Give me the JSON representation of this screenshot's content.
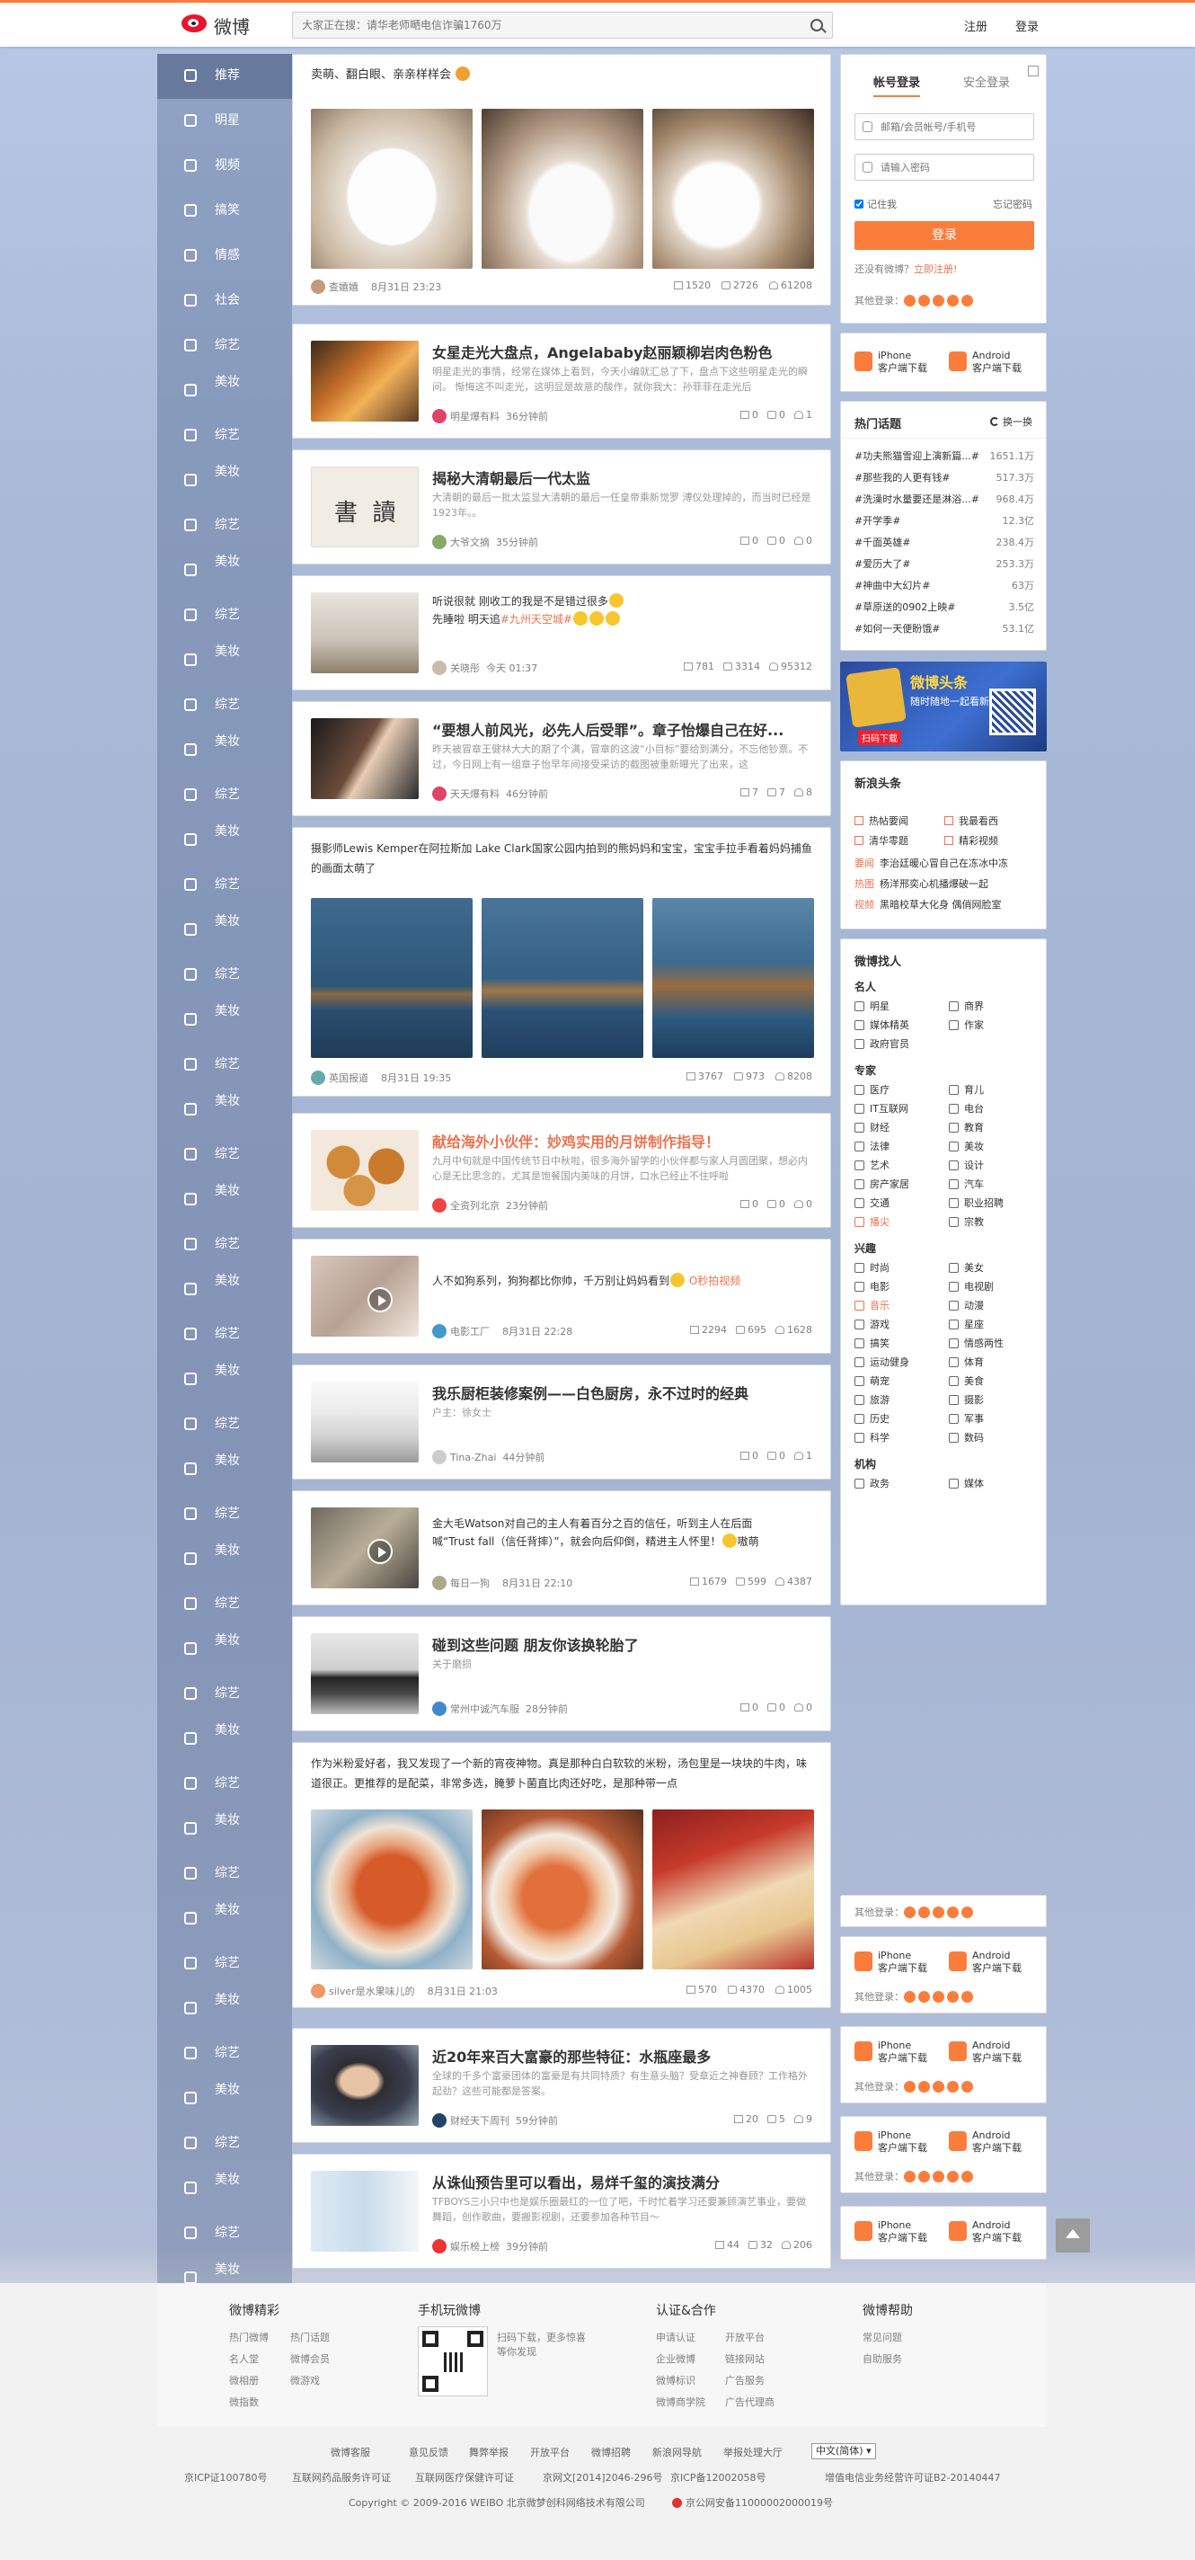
{
  "top": {
    "logo_text": "微博",
    "search_placeholder": "大家正在搜：请华老师嗮电信诈骗1760万",
    "register": "注册",
    "login": "登录"
  },
  "nav": {
    "items": [
      {
        "label": "推荐"
      },
      {
        "label": "明星"
      },
      {
        "label": "视频"
      },
      {
        "label": "搞笑"
      },
      {
        "label": "情感"
      },
      {
        "label": "社会"
      },
      {
        "label": "综艺"
      },
      {
        "label": "美妆"
      },
      {
        "label": "综艺"
      },
      {
        "label": "美妆"
      },
      {
        "label": "综艺"
      },
      {
        "label": "美妆"
      },
      {
        "label": "综艺"
      },
      {
        "label": "美妆"
      },
      {
        "label": "综艺"
      },
      {
        "label": "美妆"
      },
      {
        "label": "综艺"
      },
      {
        "label": "美妆"
      },
      {
        "label": "综艺"
      },
      {
        "label": "美妆"
      },
      {
        "label": "综艺"
      },
      {
        "label": "美妆"
      },
      {
        "label": "综艺"
      },
      {
        "label": "美妆"
      },
      {
        "label": "综艺"
      },
      {
        "label": "美妆"
      },
      {
        "label": "综艺"
      },
      {
        "label": "美妆"
      },
      {
        "label": "综艺"
      },
      {
        "label": "美妆"
      },
      {
        "label": "综艺"
      },
      {
        "label": "美妆"
      },
      {
        "label": "综艺"
      },
      {
        "label": "美妆"
      },
      {
        "label": "综艺"
      },
      {
        "label": "美妆"
      },
      {
        "label": "综艺"
      },
      {
        "label": "美妆"
      },
      {
        "label": "综艺"
      },
      {
        "label": "美妆"
      },
      {
        "label": "综艺"
      },
      {
        "label": "美妆"
      },
      {
        "label": "综艺"
      },
      {
        "label": "美妆"
      },
      {
        "label": "综艺"
      },
      {
        "label": "美妆"
      },
      {
        "label": "综艺"
      },
      {
        "label": "美妆"
      },
      {
        "label": "综艺"
      },
      {
        "label": "美妆"
      }
    ]
  },
  "feed": {
    "post1": {
      "text": "卖萌、翻白眼、亲亲样样会",
      "author": "查嬉嬉",
      "time": "8月31日 23:23",
      "repost": "1520",
      "comment": "2726",
      "like": "61208"
    },
    "post2": {
      "title": "女星走光大盘点，Angelababy赵丽颖柳岩肉色粉色",
      "desc": "明星走光的事情，经常在媒体上看到，今天小编就汇总了下，盘点下这些明星走光的瞬间。 惭悔这不叫走光，这明显是故意的酸作，就你我大：孙菲菲在走光后",
      "author": "明星爆有料",
      "time": "36分钟前",
      "repost": "0",
      "comment": "0",
      "like": "1"
    },
    "post3": {
      "title": "揭秘大清朝最后一代太监",
      "desc": "大清朝的最后一批太监显大清朝的最后一任皇帝乘新觉罗 溥仪处理掉的，而当时已经是1923年。。",
      "author": "大爷文摘",
      "time": "35分钟前",
      "repost": "0",
      "comment": "0",
      "like": "0"
    },
    "post4": {
      "line1": "听说很就 刚收工的我是不是错过很多",
      "line2a": "先睡啦 明天追",
      "line2b": "#九州天空城#",
      "author": "关晓彤",
      "time": "今天 01:37",
      "repost": "781",
      "comment": "3314",
      "like": "95312"
    },
    "post5": {
      "title": "“要想人前风光，必先人后受罪”。章子怡爆自己在好...",
      "desc": "昨天被冒章王健林大大的期了个满，冒章的这波“小目标”要给到满分，不忘他钞票。不过，今日网上有一组章子怡早年间接受采访的截图被重新曝光了出来，这",
      "author": "天天爆有料",
      "time": "46分钟前",
      "repost": "7",
      "comment": "7",
      "like": "8"
    },
    "post6": {
      "text": "摄影师Lewis Kemper在阿拉斯加 Lake Clark国家公园内拍到的熊妈妈和宝宝，宝宝手拉手看着妈妈捕鱼的画面太萌了",
      "author": "英国报道",
      "time": "8月31日 19:35",
      "repost": "3767",
      "comment": "973",
      "like": "8208"
    },
    "post7": {
      "title": "献给海外小伙伴：妙鸡实用的月饼制作指导！",
      "desc": "九月中旬就是中国传统节日中秋啦，很多海外留学的小伙伴都与家人月圆团聚，想必内心是无比思念的，尤其是饱餐国内美味的月饼，口水已经止不住呼啦",
      "author": "全资列北京",
      "time": "23分钟前",
      "repost": "0",
      "comment": "0",
      "like": "0"
    },
    "post8": {
      "text_a": "人不如狗系列，狗狗都比你帅，千万别让妈妈看到",
      "text_b": "O秒拍视频",
      "author": "电影工厂",
      "time": "8月31日 22:28",
      "repost": "2294",
      "comment": "695",
      "like": "1628"
    },
    "post9": {
      "title": "我乐厨柜装修案例——白色厨房，永不过时的经典",
      "desc": "户主：徐女士",
      "author": "Tina-Zhai",
      "time": "44分钟前",
      "repost": "0",
      "comment": "0",
      "like": "1"
    },
    "post10": {
      "line1": "金大毛Watson对自己的主人有着百分之百的信任，听到主人在后面",
      "line2": "喊“Trust fall（信任背摔）”，就会向后仰倒，精进主人怀里！",
      "line2b": "嗷萌",
      "author": "每日一狗",
      "time": "8月31日 22:10",
      "repost": "1679",
      "comment": "599",
      "like": "4387"
    },
    "post11": {
      "title": "碰到这些问题 朋友你该换轮胎了",
      "desc": "关于磨损",
      "author": "常州中诚汽车服",
      "time": "28分钟前",
      "repost": "0",
      "comment": "0",
      "like": "0"
    },
    "post12": {
      "text": "作为米粉爱好者，我又发现了一个新的宵夜神物。真是那种白白软软的米粉，汤包里是一块块的牛肉，味道很正。更推荐的是配菜，非常多选，腌萝卜菌直比肉还好吃，是那种带一点",
      "author": "silver是水果味儿的",
      "time": "8月31日 21:03",
      "repost": "570",
      "comment": "4370",
      "like": "1005"
    },
    "post13": {
      "title": "近20年来百大富豪的那些特征：水瓶座最多",
      "desc": "全球的千多个富豪团体的富豪是有共同特质？有生意头脑？受章近之神眷顾？工作格外起劲？这些可能都是答案。",
      "author": "财经天下周刊",
      "time": "59分钟前",
      "repost": "20",
      "comment": "5",
      "like": "9"
    },
    "post14": {
      "title": "从诛仙预告里可以看出，易烊千玺的演技满分",
      "desc": "TFBOYS三小只中也是娱乐圈最红的一位了吧，千时忙着学习还要兼顾演艺事业，要做舞蹈，创作歌曲，要搬影视剧，还要参加各种节目～",
      "author": "娱乐榜上榜",
      "time": "39分钟前",
      "repost": "44",
      "comment": "32",
      "like": "206"
    }
  },
  "login": {
    "tab_account": "帐号登录",
    "tab_secure": "安全登录",
    "user_placeholder": "邮箱/会员帐号/手机号",
    "pass_placeholder": "请输入密码",
    "remember": "记住我",
    "forgot": "忘记密码",
    "button": "登录",
    "noaccount": "还没有微博？",
    "register_now": "立即注册!",
    "other_login": "其他登录："
  },
  "app": {
    "iphone": "iPhone",
    "iphone_sub": "客户端下载",
    "android": "Android",
    "android_sub": "客户端下载"
  },
  "hot": {
    "title": "热门话题",
    "refresh": "换一换",
    "rows": [
      {
        "topic": "#功夫熊猫雪迎上演新篇...#",
        "value": "1651.1万"
      },
      {
        "topic": "#那些我的人更有钱#",
        "value": "517.3万"
      },
      {
        "topic": "#洗澡时水量要还是淋浴...#",
        "value": "968.4万"
      },
      {
        "topic": "#开学季#",
        "value": "12.3亿"
      },
      {
        "topic": "#千面英雄#",
        "value": "238.4万"
      },
      {
        "topic": "#爱历大了#",
        "value": "253.3万"
      },
      {
        "topic": "#神曲中大幻片#",
        "value": "63万"
      },
      {
        "topic": "#草原送的0902上映#",
        "value": "3.5亿"
      },
      {
        "topic": "#如何一天便盼饿#",
        "value": "53.1亿"
      }
    ]
  },
  "ad": {
    "line1": "微博头条",
    "line2": "随时随地一起看新闻",
    "line3": "扫码下载"
  },
  "news": {
    "title": "新浪头条",
    "r1a": "热帖要闻",
    "r1b": "我最看西",
    "r2a": "清华零题",
    "r2b": "精彩视频",
    "r3tag": "要闻",
    "r3": "李治廷暖心冒自己在冻冰中冻",
    "r4tag": "热图",
    "r4": "杨洋邢奕心机播爆破一起",
    "r5tag": "视频",
    "r5": "黑暗校草大化身 偶俏网脸室"
  },
  "finder": {
    "title": "微博找人",
    "sec1": "名人",
    "mingren": [
      [
        "明星",
        "商界"
      ],
      [
        "媒体精英",
        "作家"
      ],
      [
        "政府官员",
        ""
      ]
    ],
    "sec2": "专家",
    "zhuanjia": [
      [
        "医疗",
        "育儿"
      ],
      [
        "IT互联网",
        "电台"
      ],
      [
        "财经",
        "教育"
      ],
      [
        "法律",
        "美妆"
      ],
      [
        "艺术",
        "设计"
      ],
      [
        "房产家居",
        "汽车"
      ],
      [
        "交通",
        "职业招聘"
      ],
      [
        "播尖",
        "宗教"
      ]
    ],
    "sec3": "兴趣",
    "xingqu": [
      [
        "时尚",
        "美女"
      ],
      [
        "电影",
        "电视剧"
      ],
      [
        "音乐",
        "动漫"
      ],
      [
        "游戏",
        "星座"
      ],
      [
        "搞笑",
        "情感两性"
      ],
      [
        "运动健身",
        "体育"
      ],
      [
        "萌宠",
        "美食"
      ],
      [
        "旅游",
        "摄影"
      ],
      [
        "历史",
        "军事"
      ],
      [
        "科学",
        "数码"
      ]
    ],
    "sec4": "机构",
    "jigou": [
      [
        "政务",
        "媒体"
      ]
    ]
  },
  "footer": {
    "col1_title": "微博精彩",
    "col1_links": [
      [
        "热门微博",
        "热门话题"
      ],
      [
        "名人堂",
        "微博会员"
      ],
      [
        "微相册",
        "微游戏"
      ],
      [
        "微指数",
        ""
      ]
    ],
    "col2_title": "手机玩微博",
    "col2_text1": "扫码下载，更多惊喜",
    "col2_text2": "等你发现",
    "col3_title": "认证&合作",
    "col3_links": [
      [
        "申请认证",
        "开放平台"
      ],
      [
        "企业微博",
        "链接网站"
      ],
      [
        "微博标识",
        "广告服务"
      ],
      [
        "微博商学院",
        "广告代理商"
      ]
    ],
    "col4_title": "微博帮助",
    "col4_links": [
      "常见问题",
      "自助服务"
    ],
    "bar1": [
      "微博客服",
      "意见反馈",
      "舞弊举报",
      "开放平台",
      "微博招聘",
      "新浪网导航",
      "举报处理大厅"
    ],
    "lang": "中文(简体) ▾",
    "bar2": [
      "京ICP证100780号",
      "互联网药品服务许可证",
      "互联网医疗保健许可证",
      "京网文[2014]2046-296号",
      "京ICP备12002058号",
      "增值电信业务经营许可证B2-20140447"
    ],
    "copyright": "Copyright © 2009-2016 WEIBO 北京微梦创科网络技术有限公司",
    "police": "京公网安备11000002000019号"
  }
}
